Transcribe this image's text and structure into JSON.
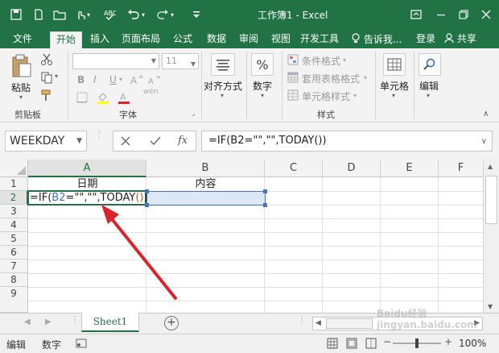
{
  "window": {
    "title": "工作簿1 - Excel",
    "accent": "#217346"
  },
  "tabs": [
    {
      "label": "文件"
    },
    {
      "label": "开始",
      "active": true
    },
    {
      "label": "插入"
    },
    {
      "label": "页面布局"
    },
    {
      "label": "公式"
    },
    {
      "label": "数据"
    },
    {
      "label": "审阅"
    },
    {
      "label": "视图"
    },
    {
      "label": "开发工具"
    }
  ],
  "tell_me": "告诉我...",
  "login": "登录",
  "share": "共享",
  "ribbon": {
    "clipboard": {
      "paste": "粘贴",
      "group": "剪贴板"
    },
    "font": {
      "name": "",
      "size": "11",
      "group": "字体",
      "bold": "B",
      "italic": "I",
      "underline": "U",
      "wen": "wén"
    },
    "alignment": {
      "label": "对齐方式"
    },
    "number": {
      "label": "数字",
      "symbol": "%"
    },
    "styles": {
      "conditional": "条件格式",
      "table": "套用表格格式",
      "cell_styles": "单元格样式",
      "group": "样式"
    },
    "cells": {
      "label": "单元格"
    },
    "editing": {
      "label": "编辑"
    }
  },
  "formula_bar": {
    "name_box": "WEEKDAY",
    "fx": "fx",
    "formula": "=IF(B2=\"\",\"\",TODAY())"
  },
  "grid": {
    "columns": [
      "A",
      "B",
      "C",
      "D",
      "E",
      "F"
    ],
    "rows": [
      "1",
      "2",
      "3",
      "4",
      "5",
      "6",
      "7",
      "8",
      "9"
    ],
    "a1": "日期",
    "b1": "内容",
    "a2_parts": {
      "p1": "=IF(",
      "p2": "B2",
      "p3": "=\"\",\"\",TODAY",
      "p4": "(",
      "p5": ")",
      "p6": ")"
    },
    "ref_color": "#4472c4",
    "paren_color": "#c55a11"
  },
  "sheet_tab": "Sheet1",
  "status": {
    "mode1": "编辑",
    "mode2": "数字",
    "zoom": "100%"
  },
  "watermark": "Baidu经验 jingyan.baidu.com"
}
